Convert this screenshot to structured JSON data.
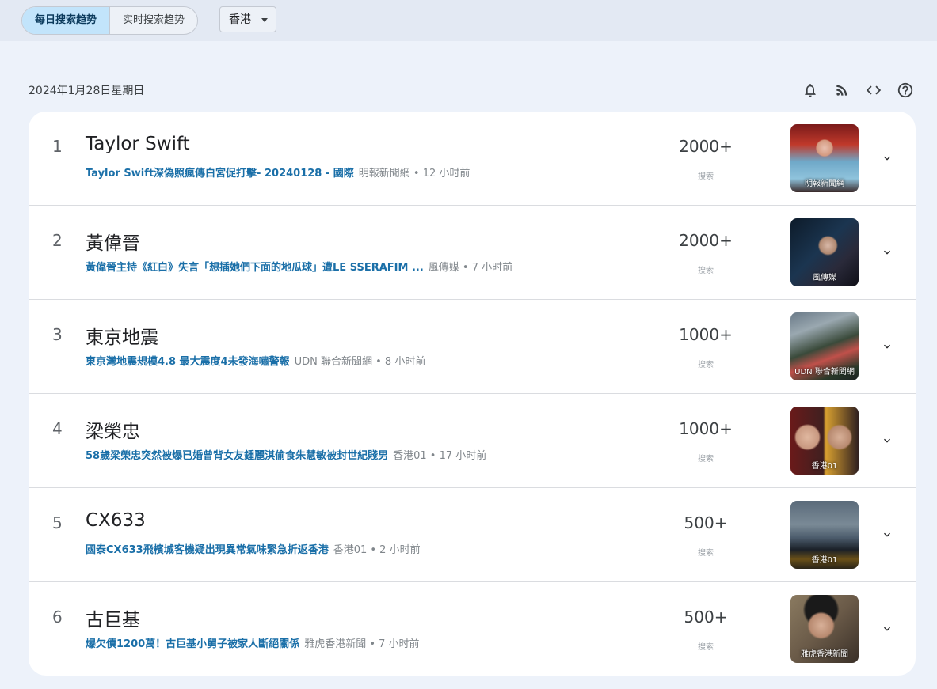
{
  "tabs": {
    "daily": "每日搜索趋势",
    "realtime": "实时搜索趋势"
  },
  "region": "香港",
  "date": "2024年1月28日星期日",
  "icons": [
    "bell-icon",
    "rss-icon",
    "code-icon",
    "help-icon"
  ],
  "colors": {
    "link": "#1a6fa8",
    "active_tab": "#c2e4fb",
    "background": "#edf2fa"
  },
  "trends": [
    {
      "rank": "1",
      "title": "Taylor Swift",
      "headline": "Taylor Swift深偽照瘋傳白宮促打擊- 20240128 - 國際",
      "meta": "明報新聞網 • 12 小时前",
      "count": "2000+",
      "count_label": "搜索",
      "thumb_source": "明報新聞網"
    },
    {
      "rank": "2",
      "title": "黃偉晉",
      "headline": "黃偉晉主持《紅白》失言「想插她們下面的地瓜球」遭LE SSERAFIM ...",
      "meta": "風傳媒 • 7 小时前",
      "count": "2000+",
      "count_label": "搜索",
      "thumb_source": "風傳媒"
    },
    {
      "rank": "3",
      "title": "東京地震",
      "headline": "東京灣地震規模4.8 最大震度4未發海嘯警報",
      "meta": "UDN 聯合新聞網 • 8 小时前",
      "count": "1000+",
      "count_label": "搜索",
      "thumb_source": "UDN 聯合新聞網"
    },
    {
      "rank": "4",
      "title": "梁榮忠",
      "headline": "58歲梁榮忠突然被爆已婚曾背女友鍾麗淇偷食朱慧敏被封世紀賤男",
      "meta": "香港01 • 17 小时前",
      "count": "1000+",
      "count_label": "搜索",
      "thumb_source": "香港01"
    },
    {
      "rank": "5",
      "title": "CX633",
      "headline": "國泰CX633飛檳城客機疑出現異常氣味緊急折返香港",
      "meta": "香港01 • 2 小时前",
      "count": "500+",
      "count_label": "搜索",
      "thumb_source": "香港01"
    },
    {
      "rank": "6",
      "title": "古巨基",
      "headline": "爆欠債1200萬！古巨基小舅子被家人斷絕關係",
      "meta": "雅虎香港新聞 • 7 小时前",
      "count": "500+",
      "count_label": "搜索",
      "thumb_source": "雅虎香港新聞"
    }
  ]
}
